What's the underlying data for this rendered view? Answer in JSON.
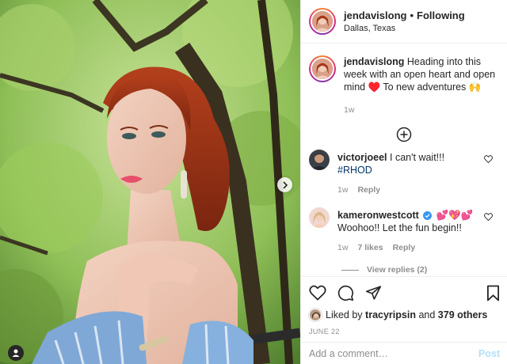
{
  "post": {
    "author": "jendavislong",
    "follow_separator": "•",
    "follow_status": "Following",
    "location": "Dallas, Texas",
    "caption": "Heading into this week with an open heart and open mind ♥️ To new adventures 🙌",
    "caption_age": "1w",
    "date": "JUNE 22"
  },
  "comments": [
    {
      "user": "victorjoeel",
      "text_before": "I can't wait!!! ",
      "hashtag": "#RHOD",
      "age": "1w",
      "reply_label": "Reply"
    },
    {
      "user": "kameronwestcott",
      "verified": true,
      "badge_emoji": "💕💖💕",
      "text": "Woohoo!! Let the fun begin!!",
      "age": "1w",
      "likes": "7 likes",
      "reply_label": "Reply",
      "view_replies": "View replies (2)"
    }
  ],
  "likes": {
    "prefix": "Liked by",
    "user": "tracyripsin",
    "connector": "and",
    "others": "379 others"
  },
  "composer": {
    "placeholder": "Add a comment…",
    "post_label": "Post"
  },
  "colors": {
    "link_blue": "#00376b",
    "verified_blue": "#3897f0",
    "muted": "#8e8e8e",
    "post_disabled": "#b2dffc"
  },
  "icons": [
    "chevron-right-icon",
    "user-tag-icon",
    "plus-circle-icon",
    "heart-icon",
    "comment-icon",
    "share-icon",
    "bookmark-icon",
    "verified-icon"
  ]
}
